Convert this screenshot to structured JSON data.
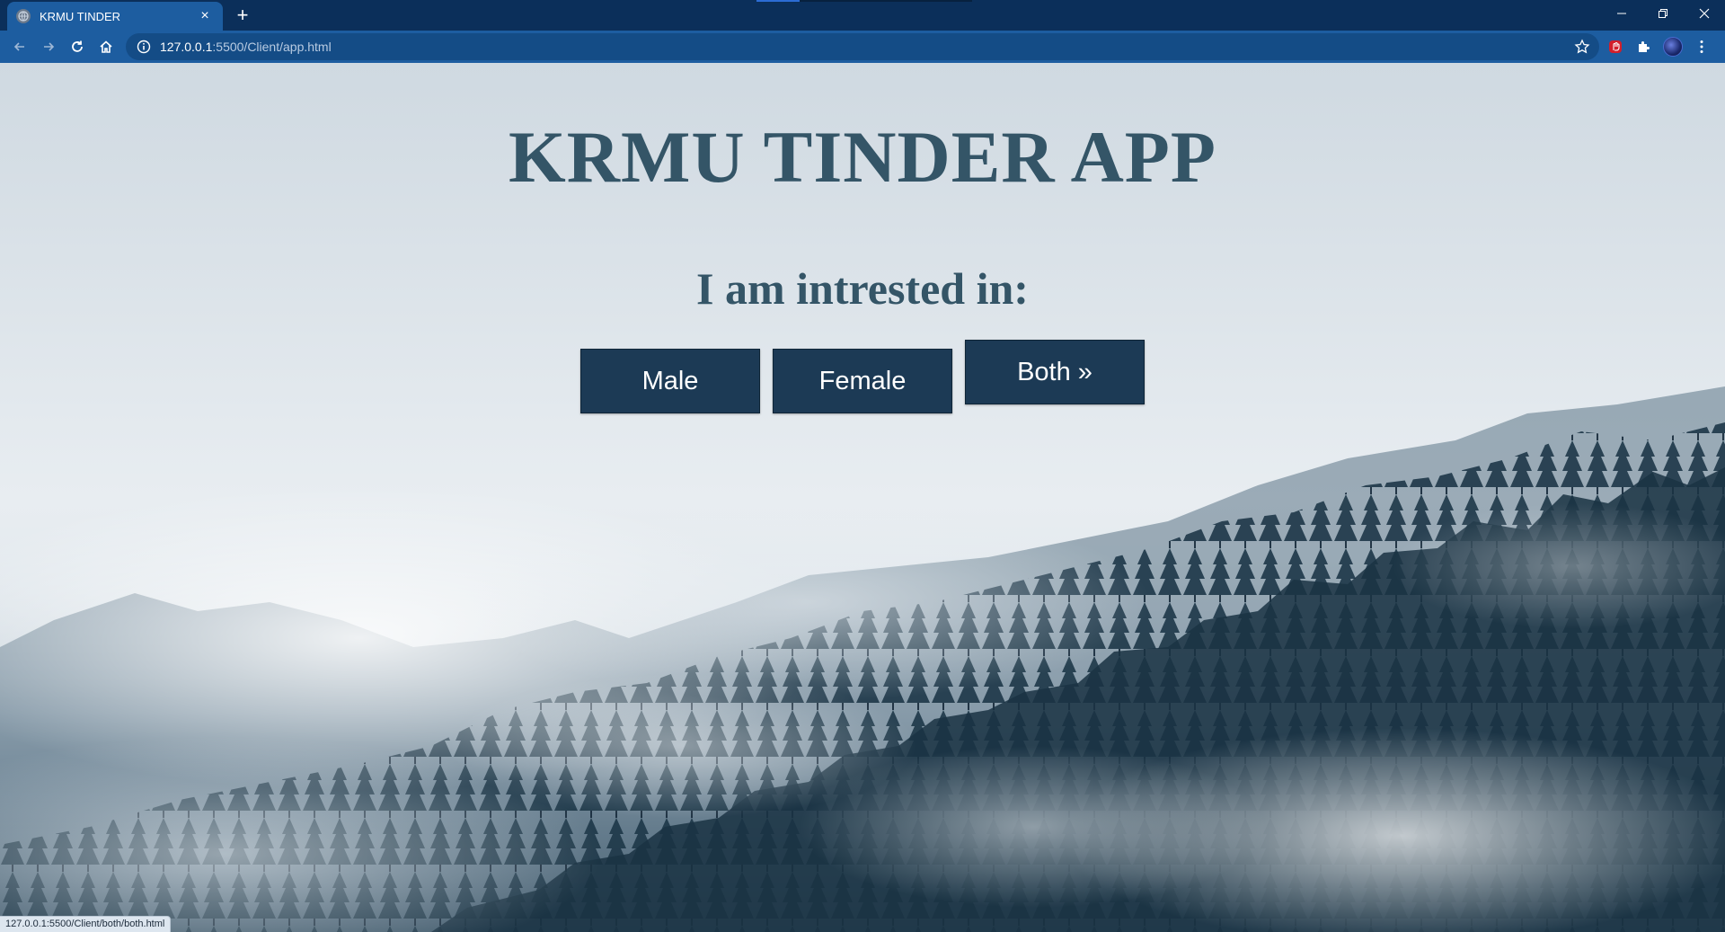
{
  "browser": {
    "tab_title": "KRMU TINDER",
    "url_host": "127.0.0.1",
    "url_path": ":5500/Client/app.html",
    "status_url": "127.0.0.1:5500/Client/both/both.html"
  },
  "page": {
    "title": "KRMU TINDER APP",
    "subtitle": "I am intrested in:",
    "buttons": {
      "male": "Male",
      "female": "Female",
      "both": "Both »"
    }
  },
  "colors": {
    "chrome_bg": "#0b2f5a",
    "toolbar_bg": "#1d5da0",
    "heading": "#345567",
    "button_bg": "#1c3a55"
  }
}
